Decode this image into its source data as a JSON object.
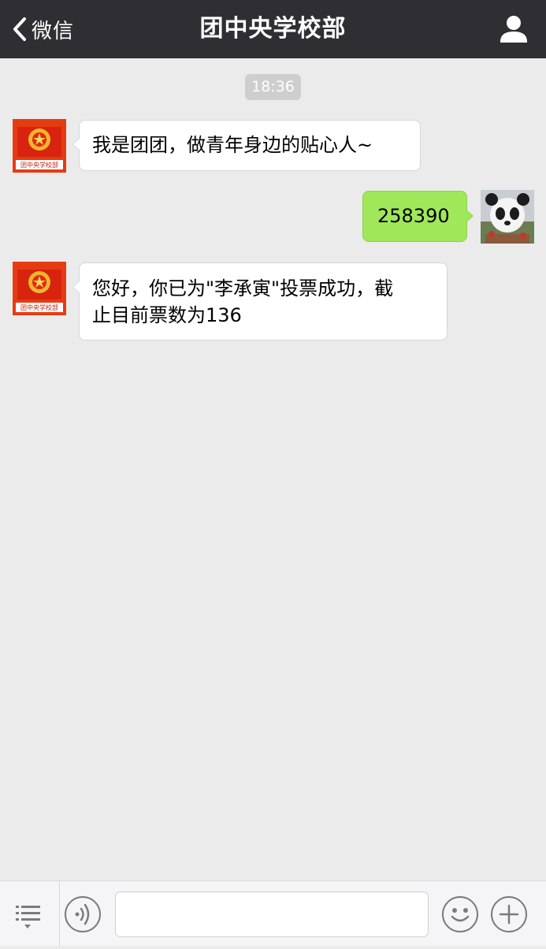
{
  "header": {
    "back_label": "微信",
    "title": "团中央学校部"
  },
  "chat": {
    "time": "18:36",
    "messages": [
      {
        "side": "left",
        "sender_avatar": "youth-league-emblem",
        "avatar_text": "团中央学校部",
        "text": "我是团团，做青年身边的贴心人~"
      },
      {
        "side": "right",
        "sender_avatar": "panda-photo",
        "text": "258390"
      },
      {
        "side": "left",
        "sender_avatar": "youth-league-emblem",
        "avatar_text": "团中央学校部",
        "text_line1": "您好，你已为\"李承寅\"投票成功，截",
        "text_line2": "止目前票数为136"
      }
    ]
  },
  "input": {
    "value": "",
    "placeholder": ""
  },
  "colors": {
    "header_bg": "#2f2f33",
    "chat_bg": "#ebebeb",
    "sent_bubble": "#a0e75a",
    "received_bubble": "#ffffff"
  },
  "icons": {
    "back": "chevron-left-icon",
    "profile": "person-icon",
    "menu": "list-menu-icon",
    "voice": "voice-icon",
    "emoji": "smiley-icon",
    "more": "plus-icon"
  }
}
